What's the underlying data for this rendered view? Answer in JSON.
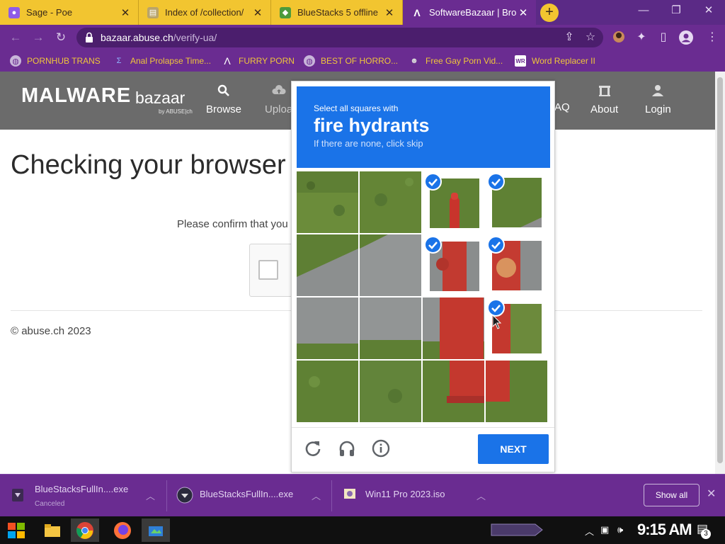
{
  "browser": {
    "tabs": [
      {
        "title": "Sage - Poe",
        "active": false
      },
      {
        "title": "Index of /collection/",
        "active": false
      },
      {
        "title": "BlueStacks 5 offline",
        "active": false
      },
      {
        "title": "SoftwareBazaar | Bro",
        "active": true
      }
    ],
    "url": {
      "host": "bazaar.abuse.ch",
      "path": "/verify-ua/"
    },
    "bookmarks": [
      {
        "label": "PORNHUB TRANS"
      },
      {
        "label": "Anal Prolapse Time..."
      },
      {
        "label": "FURRY PORN"
      },
      {
        "label": "BEST OF HORRO..."
      },
      {
        "label": "Free Gay Porn Vid..."
      },
      {
        "label": "Word Replacer II"
      }
    ],
    "colors": {
      "frame": "#6a2c91",
      "inactive_tab": "#f2c530",
      "bookmark_text": "#f0c63a"
    }
  },
  "site": {
    "logo_main": "MALWARE",
    "logo_sub": "bazaar",
    "logo_by": "by ABUSE|ch",
    "nav": [
      {
        "label": "Browse",
        "icon": "search-icon"
      },
      {
        "label": "Uploa",
        "icon": "upload-icon"
      },
      {
        "label": "AQ",
        "icon": "faq-icon"
      },
      {
        "label": "About",
        "icon": "building-icon"
      },
      {
        "label": "Login",
        "icon": "user-icon"
      }
    ],
    "heading": "Checking your browser",
    "confirm_text": "Please confirm that you",
    "footer": "© abuse.ch 2023"
  },
  "captcha": {
    "instruction": "Select all squares with",
    "keyword": "fire hydrants",
    "hint": "If there are none, click skip",
    "selected_tiles": [
      2,
      3,
      6,
      7,
      11
    ],
    "next_label": "NEXT",
    "icons": [
      "reload-icon",
      "audio-icon",
      "info-icon"
    ],
    "accent": "#1a73e8"
  },
  "downloads": [
    {
      "name": "BlueStacksFullIn....exe",
      "status": "Canceled"
    },
    {
      "name": "BlueStacksFullIn....exe",
      "status": ""
    },
    {
      "name": "Win11 Pro 2023.iso",
      "status": ""
    }
  ],
  "downloads_show_all": "Show all",
  "taskbar": {
    "clock": "9:15 AM",
    "notification_count": "3"
  }
}
